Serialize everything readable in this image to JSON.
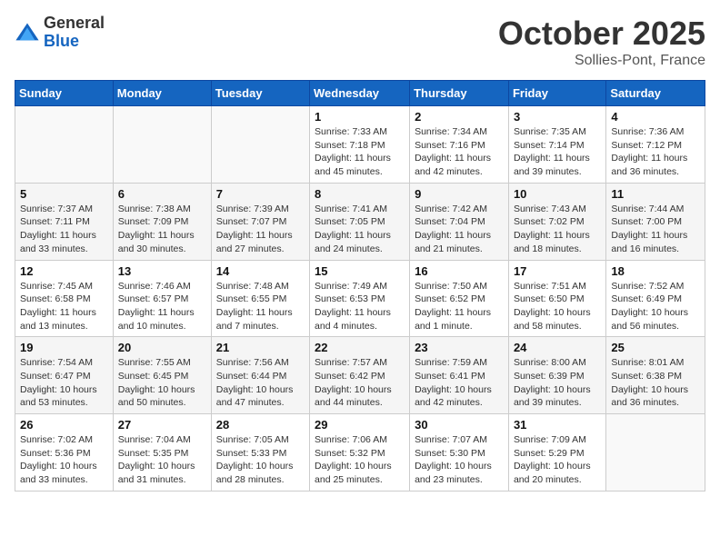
{
  "header": {
    "logo_general": "General",
    "logo_blue": "Blue",
    "month_title": "October 2025",
    "location": "Sollies-Pont, France"
  },
  "days_of_week": [
    "Sunday",
    "Monday",
    "Tuesday",
    "Wednesday",
    "Thursday",
    "Friday",
    "Saturday"
  ],
  "weeks": [
    [
      {
        "day": "",
        "info": ""
      },
      {
        "day": "",
        "info": ""
      },
      {
        "day": "",
        "info": ""
      },
      {
        "day": "1",
        "info": "Sunrise: 7:33 AM\nSunset: 7:18 PM\nDaylight: 11 hours\nand 45 minutes."
      },
      {
        "day": "2",
        "info": "Sunrise: 7:34 AM\nSunset: 7:16 PM\nDaylight: 11 hours\nand 42 minutes."
      },
      {
        "day": "3",
        "info": "Sunrise: 7:35 AM\nSunset: 7:14 PM\nDaylight: 11 hours\nand 39 minutes."
      },
      {
        "day": "4",
        "info": "Sunrise: 7:36 AM\nSunset: 7:12 PM\nDaylight: 11 hours\nand 36 minutes."
      }
    ],
    [
      {
        "day": "5",
        "info": "Sunrise: 7:37 AM\nSunset: 7:11 PM\nDaylight: 11 hours\nand 33 minutes."
      },
      {
        "day": "6",
        "info": "Sunrise: 7:38 AM\nSunset: 7:09 PM\nDaylight: 11 hours\nand 30 minutes."
      },
      {
        "day": "7",
        "info": "Sunrise: 7:39 AM\nSunset: 7:07 PM\nDaylight: 11 hours\nand 27 minutes."
      },
      {
        "day": "8",
        "info": "Sunrise: 7:41 AM\nSunset: 7:05 PM\nDaylight: 11 hours\nand 24 minutes."
      },
      {
        "day": "9",
        "info": "Sunrise: 7:42 AM\nSunset: 7:04 PM\nDaylight: 11 hours\nand 21 minutes."
      },
      {
        "day": "10",
        "info": "Sunrise: 7:43 AM\nSunset: 7:02 PM\nDaylight: 11 hours\nand 18 minutes."
      },
      {
        "day": "11",
        "info": "Sunrise: 7:44 AM\nSunset: 7:00 PM\nDaylight: 11 hours\nand 16 minutes."
      }
    ],
    [
      {
        "day": "12",
        "info": "Sunrise: 7:45 AM\nSunset: 6:58 PM\nDaylight: 11 hours\nand 13 minutes."
      },
      {
        "day": "13",
        "info": "Sunrise: 7:46 AM\nSunset: 6:57 PM\nDaylight: 11 hours\nand 10 minutes."
      },
      {
        "day": "14",
        "info": "Sunrise: 7:48 AM\nSunset: 6:55 PM\nDaylight: 11 hours\nand 7 minutes."
      },
      {
        "day": "15",
        "info": "Sunrise: 7:49 AM\nSunset: 6:53 PM\nDaylight: 11 hours\nand 4 minutes."
      },
      {
        "day": "16",
        "info": "Sunrise: 7:50 AM\nSunset: 6:52 PM\nDaylight: 11 hours\nand 1 minute."
      },
      {
        "day": "17",
        "info": "Sunrise: 7:51 AM\nSunset: 6:50 PM\nDaylight: 10 hours\nand 58 minutes."
      },
      {
        "day": "18",
        "info": "Sunrise: 7:52 AM\nSunset: 6:49 PM\nDaylight: 10 hours\nand 56 minutes."
      }
    ],
    [
      {
        "day": "19",
        "info": "Sunrise: 7:54 AM\nSunset: 6:47 PM\nDaylight: 10 hours\nand 53 minutes."
      },
      {
        "day": "20",
        "info": "Sunrise: 7:55 AM\nSunset: 6:45 PM\nDaylight: 10 hours\nand 50 minutes."
      },
      {
        "day": "21",
        "info": "Sunrise: 7:56 AM\nSunset: 6:44 PM\nDaylight: 10 hours\nand 47 minutes."
      },
      {
        "day": "22",
        "info": "Sunrise: 7:57 AM\nSunset: 6:42 PM\nDaylight: 10 hours\nand 44 minutes."
      },
      {
        "day": "23",
        "info": "Sunrise: 7:59 AM\nSunset: 6:41 PM\nDaylight: 10 hours\nand 42 minutes."
      },
      {
        "day": "24",
        "info": "Sunrise: 8:00 AM\nSunset: 6:39 PM\nDaylight: 10 hours\nand 39 minutes."
      },
      {
        "day": "25",
        "info": "Sunrise: 8:01 AM\nSunset: 6:38 PM\nDaylight: 10 hours\nand 36 minutes."
      }
    ],
    [
      {
        "day": "26",
        "info": "Sunrise: 7:02 AM\nSunset: 5:36 PM\nDaylight: 10 hours\nand 33 minutes."
      },
      {
        "day": "27",
        "info": "Sunrise: 7:04 AM\nSunset: 5:35 PM\nDaylight: 10 hours\nand 31 minutes."
      },
      {
        "day": "28",
        "info": "Sunrise: 7:05 AM\nSunset: 5:33 PM\nDaylight: 10 hours\nand 28 minutes."
      },
      {
        "day": "29",
        "info": "Sunrise: 7:06 AM\nSunset: 5:32 PM\nDaylight: 10 hours\nand 25 minutes."
      },
      {
        "day": "30",
        "info": "Sunrise: 7:07 AM\nSunset: 5:30 PM\nDaylight: 10 hours\nand 23 minutes."
      },
      {
        "day": "31",
        "info": "Sunrise: 7:09 AM\nSunset: 5:29 PM\nDaylight: 10 hours\nand 20 minutes."
      },
      {
        "day": "",
        "info": ""
      }
    ]
  ]
}
